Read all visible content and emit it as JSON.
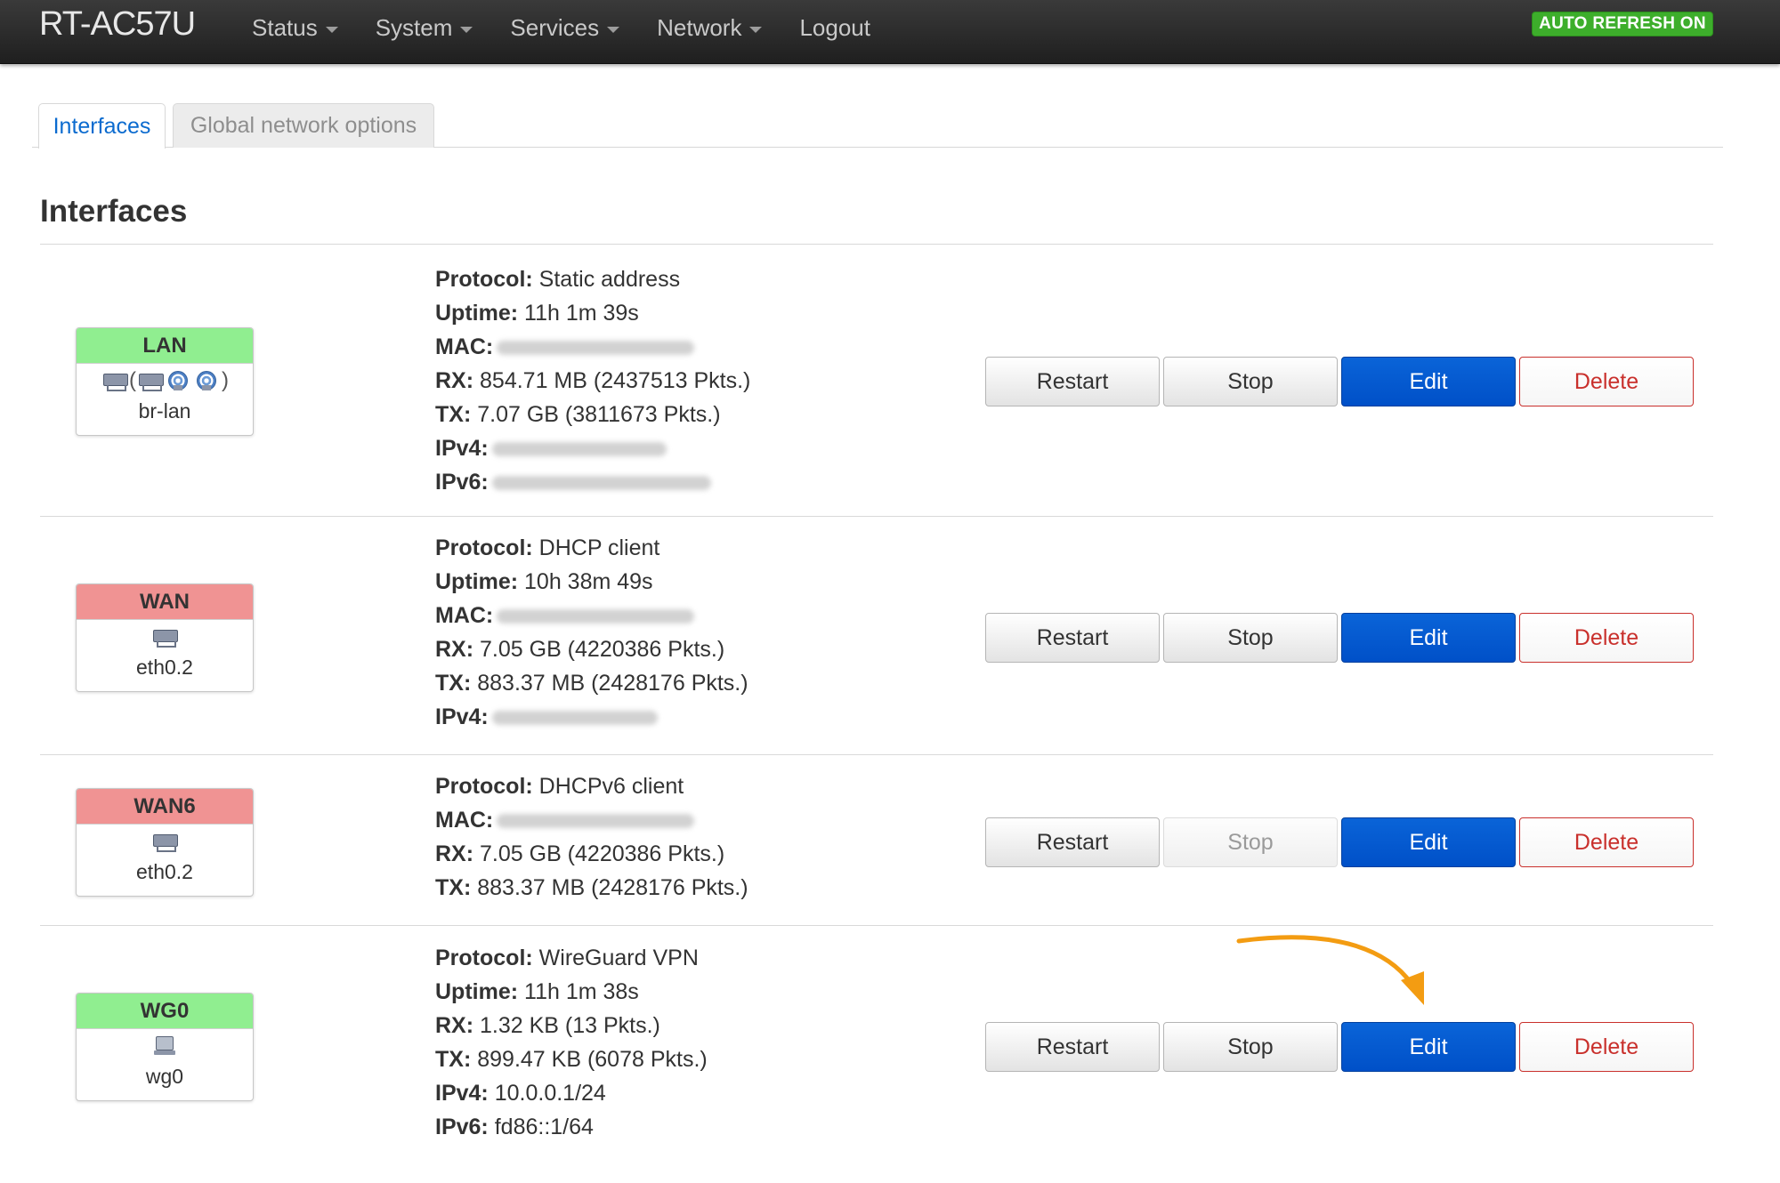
{
  "navbar": {
    "brand": "RT-AC57U",
    "menu": [
      {
        "label": "Status",
        "has_caret": true
      },
      {
        "label": "System",
        "has_caret": true
      },
      {
        "label": "Services",
        "has_caret": true
      },
      {
        "label": "Network",
        "has_caret": true
      },
      {
        "label": "Logout",
        "has_caret": false
      }
    ],
    "auto_refresh": "AUTO REFRESH ON"
  },
  "tabs": [
    {
      "label": "Interfaces",
      "active": true
    },
    {
      "label": "Global network options",
      "active": false
    }
  ],
  "section_title": "Interfaces",
  "interfaces": [
    {
      "name": "LAN",
      "status": "up",
      "device": "br-lan",
      "icons": [
        "ethernet-icon",
        "bridge-open",
        "ethernet-icon",
        "wifi-icon",
        "wifi-icon",
        "bridge-close"
      ],
      "paren_open": "(",
      "paren_close": ")",
      "info": [
        {
          "label": "Protocol:",
          "value": "Static address"
        },
        {
          "label": "Uptime:",
          "value": "11h 1m 39s"
        },
        {
          "label": "MAC:",
          "value": "",
          "blurred": true
        },
        {
          "label": "RX:",
          "value": "854.71 MB (2437513 Pkts.)"
        },
        {
          "label": "TX:",
          "value": "7.07 GB (3811673 Pkts.)"
        },
        {
          "label": "IPv4:",
          "value": "",
          "blurred": true
        },
        {
          "label": "IPv6:",
          "value": "",
          "blurred": true
        }
      ],
      "buttons": {
        "restart": "Restart",
        "stop": "Stop",
        "edit": "Edit",
        "delete": "Delete"
      },
      "stop_disabled": false
    },
    {
      "name": "WAN",
      "status": "down",
      "device": "eth0.2",
      "info": [
        {
          "label": "Protocol:",
          "value": "DHCP client"
        },
        {
          "label": "Uptime:",
          "value": "10h 38m 49s"
        },
        {
          "label": "MAC:",
          "value": "",
          "blurred": true
        },
        {
          "label": "RX:",
          "value": "7.05 GB (4220386 Pkts.)"
        },
        {
          "label": "TX:",
          "value": "883.37 MB (2428176 Pkts.)"
        },
        {
          "label": "IPv4:",
          "value": "",
          "blurred": true
        }
      ],
      "buttons": {
        "restart": "Restart",
        "stop": "Stop",
        "edit": "Edit",
        "delete": "Delete"
      },
      "stop_disabled": false
    },
    {
      "name": "WAN6",
      "status": "down",
      "device": "eth0.2",
      "info": [
        {
          "label": "Protocol:",
          "value": "DHCPv6 client"
        },
        {
          "label": "MAC:",
          "value": "",
          "blurred": true
        },
        {
          "label": "RX:",
          "value": "7.05 GB (4220386 Pkts.)"
        },
        {
          "label": "TX:",
          "value": "883.37 MB (2428176 Pkts.)"
        }
      ],
      "buttons": {
        "restart": "Restart",
        "stop": "Stop",
        "edit": "Edit",
        "delete": "Delete"
      },
      "stop_disabled": true
    },
    {
      "name": "WG0",
      "status": "up",
      "device": "wg0",
      "info": [
        {
          "label": "Protocol:",
          "value": "WireGuard VPN"
        },
        {
          "label": "Uptime:",
          "value": "11h 1m 38s"
        },
        {
          "label": "RX:",
          "value": "1.32 KB (13 Pkts.)"
        },
        {
          "label": "TX:",
          "value": "899.47 KB (6078 Pkts.)"
        },
        {
          "label": "IPv4:",
          "value": "10.0.0.1/24"
        },
        {
          "label": "IPv6:",
          "value": "fd86::1/64"
        }
      ],
      "buttons": {
        "restart": "Restart",
        "stop": "Stop",
        "edit": "Edit",
        "delete": "Delete"
      },
      "stop_disabled": false
    }
  ],
  "colors": {
    "status_up": "#90ee90",
    "status_down": "#f09393",
    "primary": "#0057d0",
    "danger": "#c9302c",
    "annotation_arrow": "#f39c12"
  }
}
